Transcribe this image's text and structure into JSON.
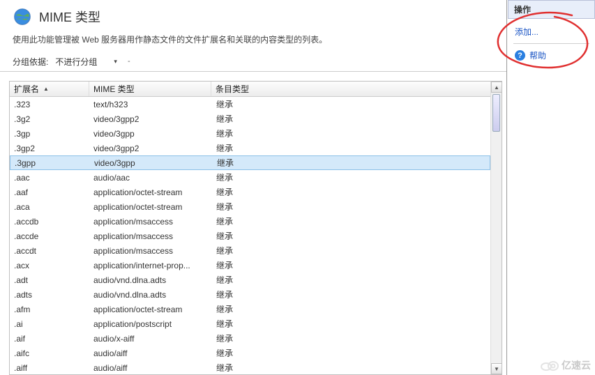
{
  "header": {
    "title": "MIME 类型",
    "subtitle": "使用此功能管理被 Web 服务器用作静态文件的文件扩展名和关联的内容类型的列表。"
  },
  "grouping": {
    "label": "分组依据:",
    "value": "不进行分组"
  },
  "columns": {
    "c1": "扩展名",
    "c2": "MIME 类型",
    "c3": "条目类型"
  },
  "selected_index": 4,
  "rows": [
    {
      "ext": ".323",
      "mime": "text/h323",
      "entry": "继承"
    },
    {
      "ext": ".3g2",
      "mime": "video/3gpp2",
      "entry": "继承"
    },
    {
      "ext": ".3gp",
      "mime": "video/3gpp",
      "entry": "继承"
    },
    {
      "ext": ".3gp2",
      "mime": "video/3gpp2",
      "entry": "继承"
    },
    {
      "ext": ".3gpp",
      "mime": "video/3gpp",
      "entry": "继承"
    },
    {
      "ext": ".aac",
      "mime": "audio/aac",
      "entry": "继承"
    },
    {
      "ext": ".aaf",
      "mime": "application/octet-stream",
      "entry": "继承"
    },
    {
      "ext": ".aca",
      "mime": "application/octet-stream",
      "entry": "继承"
    },
    {
      "ext": ".accdb",
      "mime": "application/msaccess",
      "entry": "继承"
    },
    {
      "ext": ".accde",
      "mime": "application/msaccess",
      "entry": "继承"
    },
    {
      "ext": ".accdt",
      "mime": "application/msaccess",
      "entry": "继承"
    },
    {
      "ext": ".acx",
      "mime": "application/internet-prop...",
      "entry": "继承"
    },
    {
      "ext": ".adt",
      "mime": "audio/vnd.dlna.adts",
      "entry": "继承"
    },
    {
      "ext": ".adts",
      "mime": "audio/vnd.dlna.adts",
      "entry": "继承"
    },
    {
      "ext": ".afm",
      "mime": "application/octet-stream",
      "entry": "继承"
    },
    {
      "ext": ".ai",
      "mime": "application/postscript",
      "entry": "继承"
    },
    {
      "ext": ".aif",
      "mime": "audio/x-aiff",
      "entry": "继承"
    },
    {
      "ext": ".aifc",
      "mime": "audio/aiff",
      "entry": "继承"
    },
    {
      "ext": ".aiff",
      "mime": "audio/aiff",
      "entry": "继承"
    }
  ],
  "actions": {
    "header": "操作",
    "add": "添加...",
    "help": "帮助"
  },
  "watermark": "亿速云"
}
